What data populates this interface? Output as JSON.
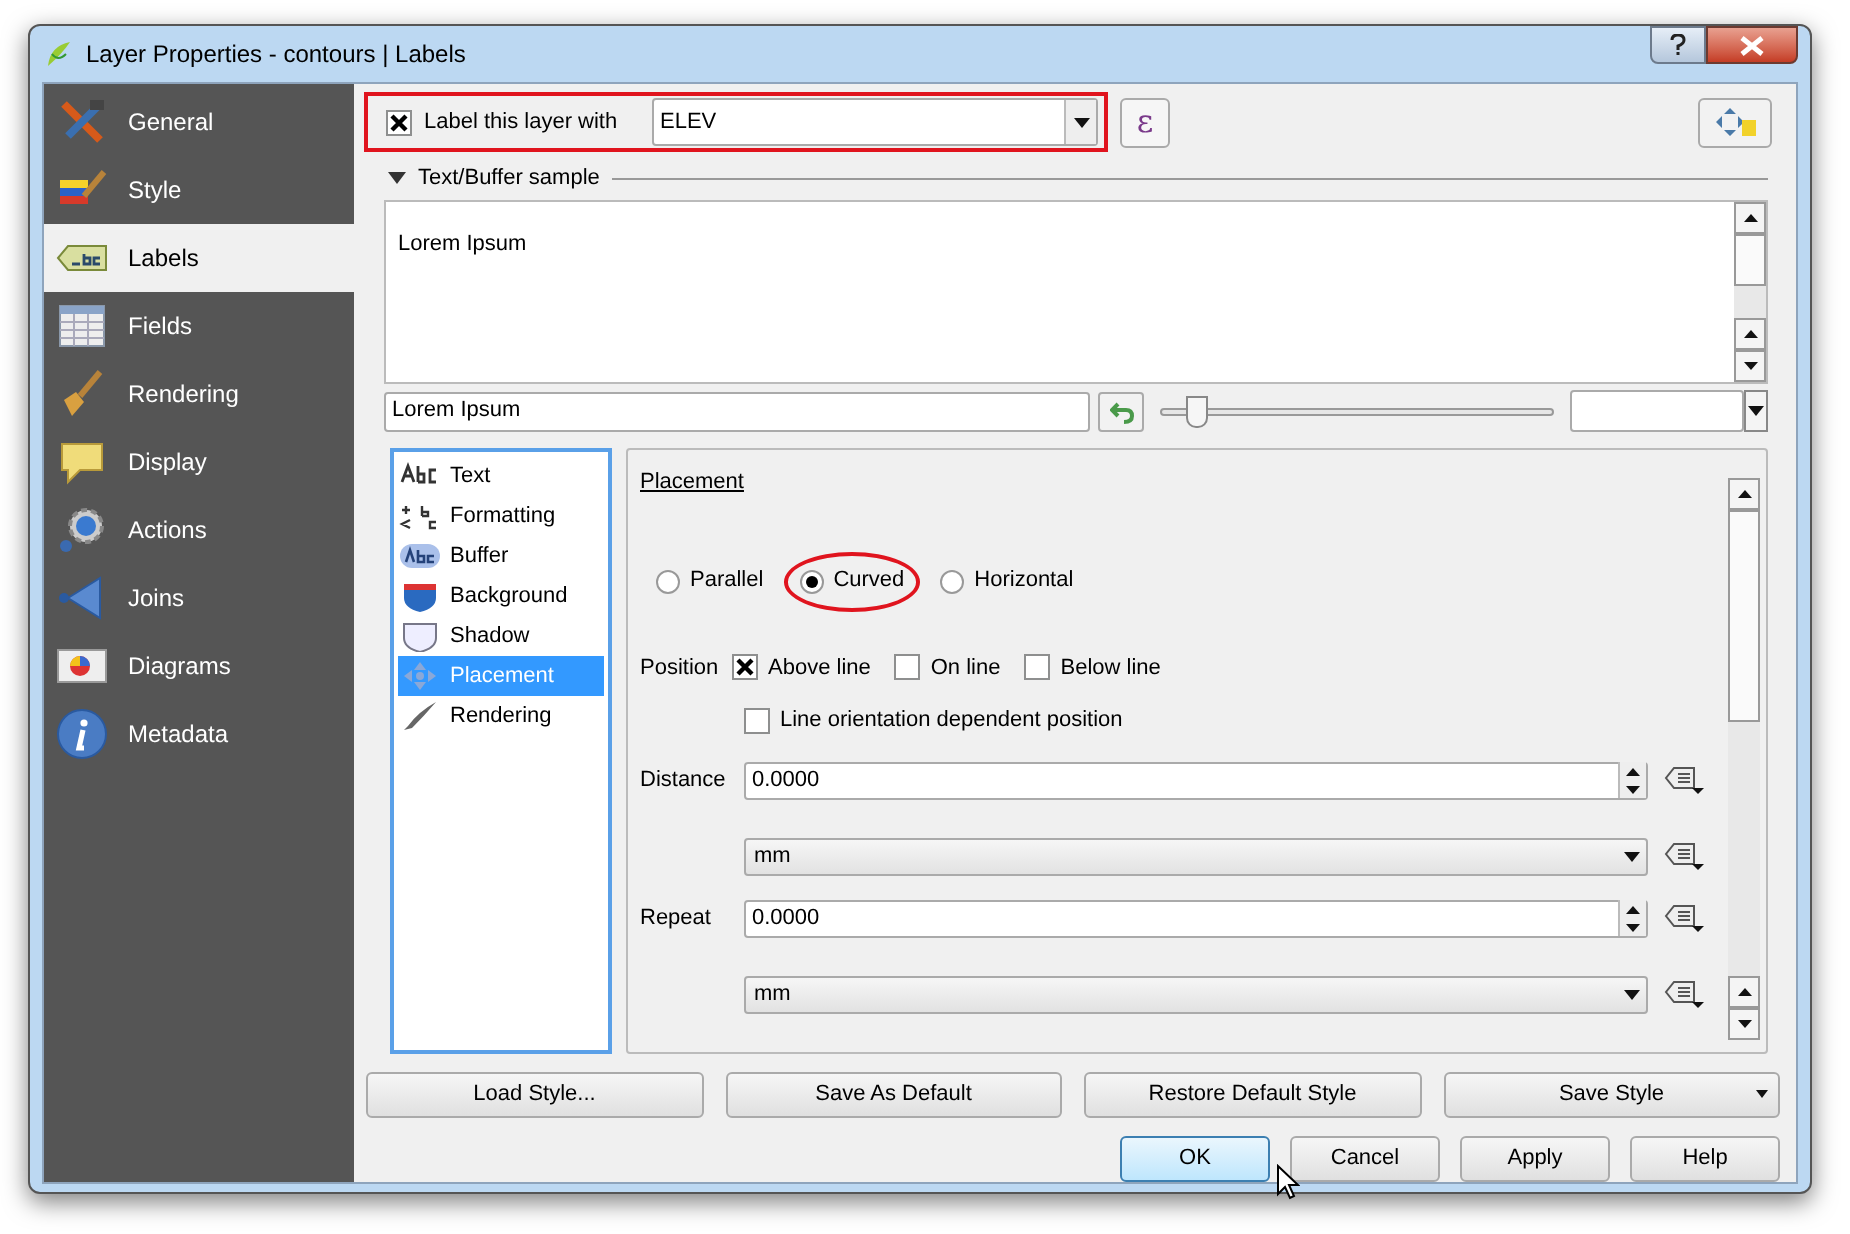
{
  "window": {
    "title": "Layer Properties - contours | Labels"
  },
  "sidebar": {
    "items": [
      {
        "label": "General",
        "selected": false
      },
      {
        "label": "Style",
        "selected": false
      },
      {
        "label": "Labels",
        "selected": true
      },
      {
        "label": "Fields",
        "selected": false
      },
      {
        "label": "Rendering",
        "selected": false
      },
      {
        "label": "Display",
        "selected": false
      },
      {
        "label": "Actions",
        "selected": false
      },
      {
        "label": "Joins",
        "selected": false
      },
      {
        "label": "Diagrams",
        "selected": false
      },
      {
        "label": "Metadata",
        "selected": false
      }
    ]
  },
  "label_toggle": {
    "label": "Label this layer with",
    "checked": true,
    "highlighted": true
  },
  "field_combo": {
    "value": "ELEV"
  },
  "expression_button": "ε",
  "sample": {
    "heading": "Text/Buffer sample",
    "expanded": true,
    "preview_text": "Lorem Ipsum",
    "input_value": "Lorem Ipsum",
    "zoom_slider": {
      "level": 0.07
    }
  },
  "tabs": [
    {
      "label": "Text",
      "selected": false
    },
    {
      "label": "Formatting",
      "selected": false
    },
    {
      "label": "Buffer",
      "selected": false
    },
    {
      "label": "Background",
      "selected": false
    },
    {
      "label": "Shadow",
      "selected": false
    },
    {
      "label": "Placement",
      "selected": true
    },
    {
      "label": "Rendering",
      "selected": false
    }
  ],
  "placement": {
    "title": "Placement",
    "modes": [
      {
        "label": "Parallel",
        "selected": false,
        "highlighted": false
      },
      {
        "label": "Curved",
        "selected": true,
        "highlighted": true
      },
      {
        "label": "Horizontal",
        "selected": false,
        "highlighted": false
      }
    ],
    "position_label": "Position",
    "positions": [
      {
        "label": "Above line",
        "checked": true
      },
      {
        "label": "On line",
        "checked": false
      },
      {
        "label": "Below line",
        "checked": false
      }
    ],
    "line_orientation": {
      "label": "Line orientation dependent position",
      "checked": false
    },
    "fields": [
      {
        "label": "Distance",
        "value": "0.0000",
        "unit": "mm"
      },
      {
        "label": "Repeat",
        "value": "0.0000",
        "unit": "mm"
      }
    ]
  },
  "style_buttons": [
    {
      "label": "Load Style...",
      "menu": false
    },
    {
      "label": "Save As Default",
      "menu": false
    },
    {
      "label": "Restore Default Style",
      "menu": false
    },
    {
      "label": "Save Style",
      "menu": true
    }
  ],
  "dialog_buttons": [
    {
      "label": "OK",
      "selected": true
    },
    {
      "label": "Cancel",
      "selected": false
    },
    {
      "label": "Apply",
      "selected": false
    },
    {
      "label": "Help",
      "selected": false
    }
  ]
}
